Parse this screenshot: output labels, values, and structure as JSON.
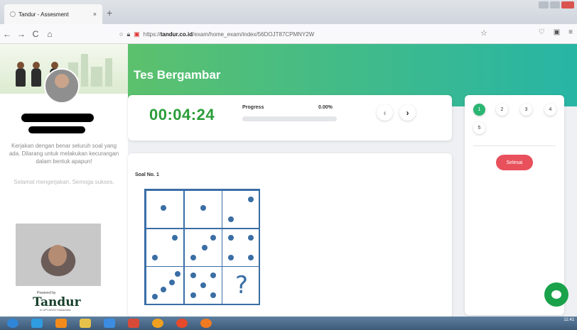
{
  "browser": {
    "tab_title": "Tandur - Assesment",
    "tab_close": "×",
    "new_tab": "+",
    "url_host": "tandur.co.id",
    "url_prefix": "https://",
    "url_path": "/exam/home_exam/index/56DOJT87CPMNY2W"
  },
  "sidebar": {
    "instructions": "Kerjakan dengan benar seluruh soal yang ada. Dilarang untuk melakukan kecurangan dalam bentuk apapun!",
    "greeting": "Selamat mengerjakan. Semoga sukses.",
    "powered_by": "Powered by",
    "logo": "Tandur",
    "logo_sub": "In UPI ADGO Nusantara"
  },
  "header": {
    "title": "Tes Bergambar"
  },
  "timer": {
    "value": "00:04:24"
  },
  "progress": {
    "label": "Progress",
    "value": "0.00%",
    "fraction": 0.0
  },
  "nav": {
    "prev_icon": "chevron-left-icon",
    "next_icon": "chevron-right-icon",
    "prev": "‹",
    "next": "›"
  },
  "question_numbers": [
    "1",
    "2",
    "3",
    "4",
    "5"
  ],
  "active_question": "1",
  "finish_label": "Selesai",
  "question": {
    "label": "Soal No. 1",
    "missing_mark": "?"
  },
  "taskbar": {
    "time": "11:41"
  },
  "colors": {
    "accent_green": "#2bb673",
    "finish_red": "#e8505b",
    "puzzle_blue": "#3a6ea5"
  }
}
